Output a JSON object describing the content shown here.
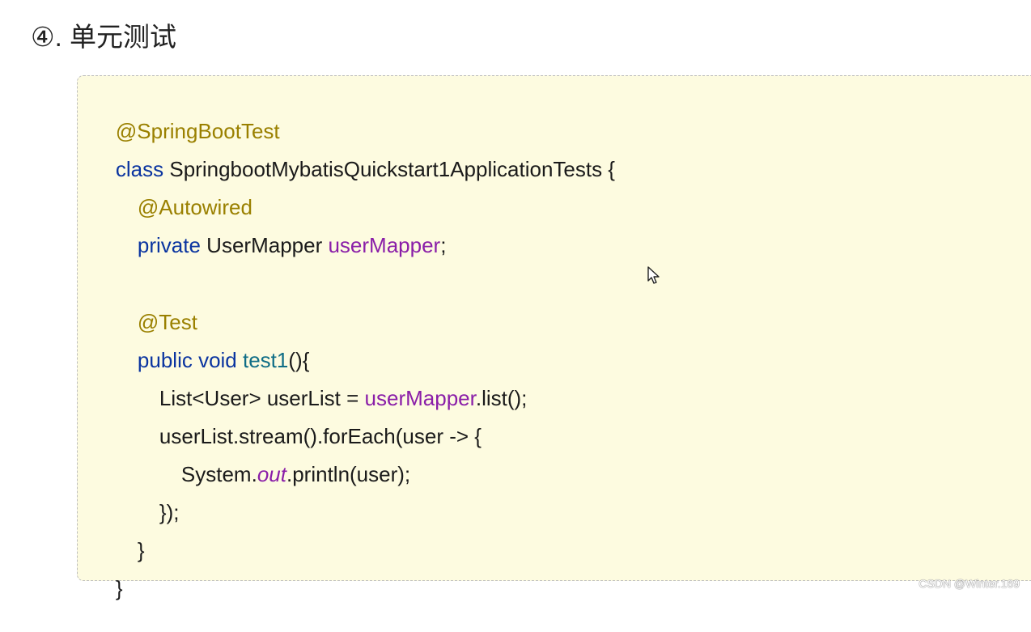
{
  "section": {
    "number": "④",
    "separator": ". ",
    "title": "单元测试"
  },
  "code": {
    "annotation_springboottest": "@SpringBootTest",
    "line2": {
      "kw": "class",
      "rest": " SpringbootMybatisQuickstart1ApplicationTests {"
    },
    "annotation_autowired": "@Autowired",
    "line4": {
      "kw": "private",
      "type": " UserMapper ",
      "field": "userMapper",
      "end": ";"
    },
    "annotation_test": "@Test",
    "line7": {
      "kw": "public void",
      "sp": " ",
      "method": "test1",
      "end": "(){"
    },
    "line8": {
      "start": "List<User> userList = ",
      "field": "userMapper",
      "end": ".list();"
    },
    "line9": "userList.stream().forEach(user -> {",
    "line10": {
      "start": "System.",
      "field": "out",
      "end": ".println(user);"
    },
    "line11": "});",
    "line12": "}",
    "line13": "}"
  },
  "watermark": "CSDN @Winter.169"
}
